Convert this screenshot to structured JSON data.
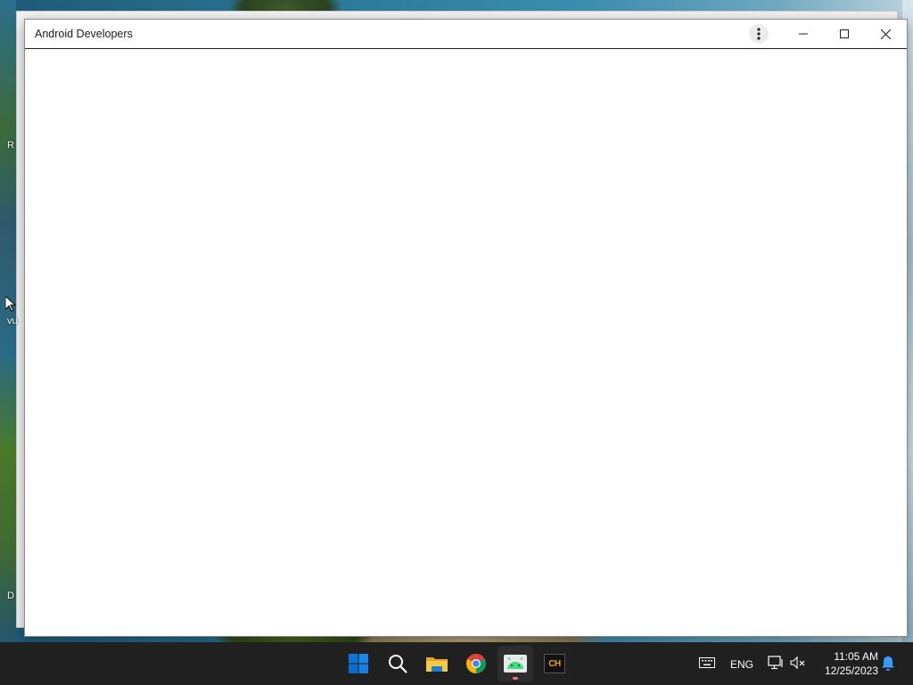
{
  "desktop": {
    "edge_labels": [
      "R",
      "vu",
      "D"
    ]
  },
  "window": {
    "title": "Android Developers",
    "controls": {
      "menu_icon": "more-vert-icon",
      "minimize_icon": "minimize-icon",
      "maximize_icon": "maximize-icon",
      "close_icon": "close-icon"
    }
  },
  "taskbar": {
    "apps": [
      {
        "name": "start",
        "icon": "windows-start-icon"
      },
      {
        "name": "search",
        "icon": "search-icon"
      },
      {
        "name": "file-explorer",
        "icon": "folder-icon"
      },
      {
        "name": "chrome",
        "icon": "chrome-icon"
      },
      {
        "name": "android-developers",
        "icon": "android-icon",
        "active": true
      },
      {
        "name": "ch-app",
        "icon": "ch-app-icon",
        "label": "CH"
      }
    ],
    "tray": {
      "keyboard_icon": "keyboard-icon",
      "language": "ENG",
      "network_icon": "network-icon",
      "volume_icon": "volume-muted-icon",
      "time": "11:05 AM",
      "date": "12/25/2023",
      "notification_icon": "bell-icon"
    }
  },
  "colors": {
    "taskbar_bg": "#202020",
    "window_bg": "#ffffff",
    "windows_blue": "#0a74d9",
    "android_green": "#3ddc84",
    "notification_blue": "#3a9bff"
  }
}
